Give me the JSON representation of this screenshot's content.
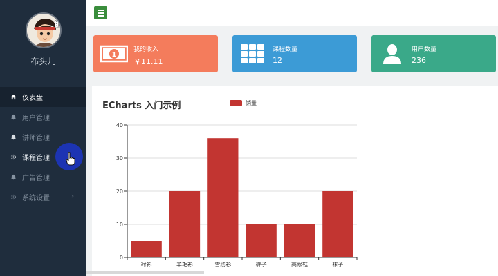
{
  "sidebar": {
    "username": "布头儿",
    "items": [
      {
        "label": "仪表盘",
        "icon": "home-icon",
        "name": "sidebar-item-dashboard"
      },
      {
        "label": "用户管理",
        "icon": "bell-icon",
        "name": "sidebar-item-users"
      },
      {
        "label": "讲师管理",
        "icon": "bell-icon",
        "name": "sidebar-item-teachers"
      },
      {
        "label": "课程管理",
        "icon": "gear-icon",
        "name": "sidebar-item-courses"
      },
      {
        "label": "广告管理",
        "icon": "bell-icon",
        "name": "sidebar-item-ads"
      },
      {
        "label": "系统设置",
        "icon": "gear-icon",
        "name": "sidebar-item-settings"
      }
    ]
  },
  "stats": [
    {
      "label": "我的收入",
      "value": "￥11.11",
      "color": "#f47c5c",
      "icon": "money-icon"
    },
    {
      "label": "课程数量",
      "value": "12",
      "color": "#3c9bd6",
      "icon": "grid-icon"
    },
    {
      "label": "用户数量",
      "value": "236",
      "color": "#3aa989",
      "icon": "user-icon"
    }
  ],
  "chart_data": {
    "type": "bar",
    "title": "ECharts 入门示例",
    "legend": [
      "销量"
    ],
    "categories": [
      "衬衫",
      "羊毛衫",
      "雪纺衫",
      "裤子",
      "高跟鞋",
      "袜子"
    ],
    "series": [
      {
        "name": "销量",
        "values": [
          5,
          20,
          36,
          10,
          10,
          20
        ],
        "color": "#c23531"
      }
    ],
    "yticks": [
      0,
      10,
      20,
      30,
      40
    ],
    "ylim": [
      0,
      40
    ],
    "grid": true,
    "legend_position": "top"
  }
}
